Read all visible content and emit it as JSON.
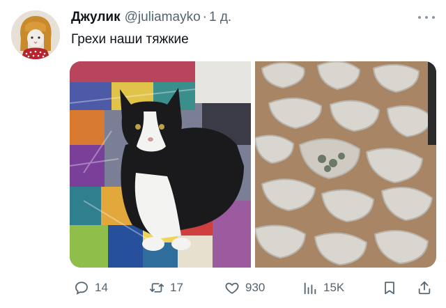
{
  "tweet": {
    "author_name": "Джулик",
    "author_handle": "@juliamayko",
    "separator": "·",
    "time": "1 д.",
    "text": "Грехи наши тяжкие"
  },
  "media": [
    {
      "icon": "photo-cat-on-quilt"
    },
    {
      "icon": "photo-dumplings"
    }
  ],
  "actions": {
    "reply_count": "14",
    "retweet_count": "17",
    "like_count": "930",
    "views_count": "15K"
  },
  "colors": {
    "text_primary": "#0f1419",
    "text_secondary": "#536471",
    "background": "#ffffff"
  }
}
